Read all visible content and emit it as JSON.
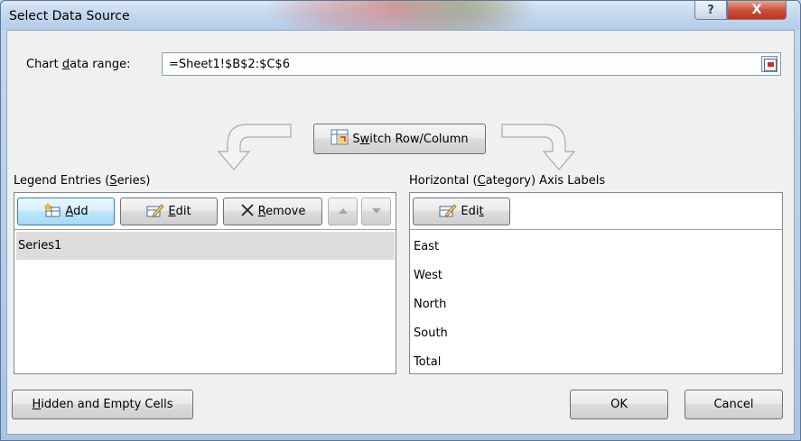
{
  "window": {
    "title": "Select Data Source",
    "help_glyph": "?",
    "close_glyph": "X"
  },
  "range": {
    "label_pre": "Chart ",
    "label_access": "d",
    "label_post": "ata range:",
    "value": "=Sheet1!$B$2:$C$6"
  },
  "switch_button": {
    "pre": "S",
    "access": "w",
    "post": "itch Row/Column"
  },
  "legend": {
    "title_pre": "Legend Entries (",
    "title_access": "S",
    "title_post": "eries)",
    "add": {
      "access": "A",
      "post": "dd"
    },
    "edit": {
      "access": "E",
      "post": "dit"
    },
    "remove": {
      "access": "R",
      "post": "emove"
    },
    "series": [
      "Series1"
    ]
  },
  "axis": {
    "title_pre": "Horizontal (",
    "title_access": "C",
    "title_post": "ategory) Axis Labels",
    "edit": {
      "pre": "Edi",
      "access": "t"
    },
    "labels": [
      "East",
      "West",
      "North",
      "South",
      "Total"
    ]
  },
  "footer": {
    "hidden_access": "H",
    "hidden_post": "idden and Empty Cells",
    "ok": "OK",
    "cancel": "Cancel"
  },
  "colors": {
    "selection": "#dcdcdc",
    "close_red": "#d0503a",
    "accent_blue": "#3c7fb1"
  }
}
